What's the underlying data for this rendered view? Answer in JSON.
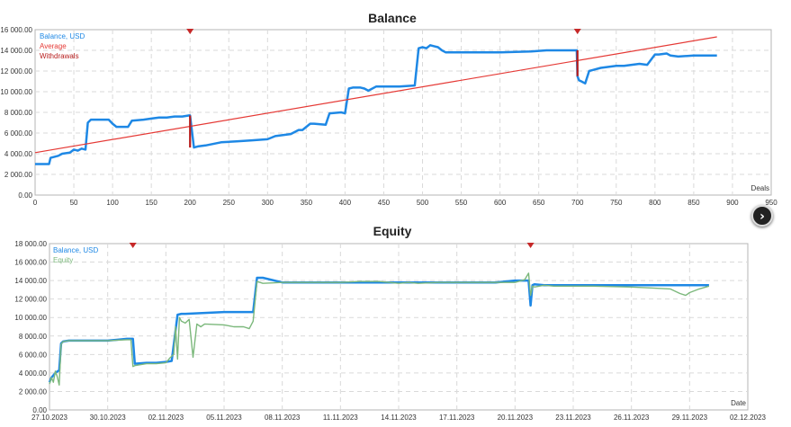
{
  "chart_data": [
    {
      "type": "line",
      "title": "Balance",
      "xlabel": "Deals",
      "ylabel": "",
      "xlim": [
        0,
        950
      ],
      "ylim": [
        0,
        16000
      ],
      "xticks": [
        0,
        50,
        100,
        150,
        200,
        250,
        300,
        350,
        400,
        450,
        500,
        550,
        600,
        650,
        700,
        750,
        800,
        850,
        900,
        950
      ],
      "xtick_labels": [
        "0",
        "50",
        "100",
        "150",
        "200",
        "250",
        "300",
        "350",
        "400",
        "450",
        "500",
        "550",
        "600",
        "650",
        "700",
        "750",
        "800",
        "850",
        "900",
        "950"
      ],
      "yticks": [
        0,
        2000,
        4000,
        6000,
        8000,
        10000,
        12000,
        14000,
        16000
      ],
      "ytick_labels": [
        "0.00",
        "2 000.00",
        "4 000.00",
        "6 000.00",
        "8 000.00",
        "10 000.00",
        "12 000.00",
        "14 000.00",
        "16 000.00"
      ],
      "grid": true,
      "legend": "top-left",
      "markers": [
        200,
        700
      ],
      "series": [
        {
          "name": "Balance, USD",
          "color": "#1e88e5",
          "x": [
            0,
            18,
            20,
            30,
            35,
            45,
            50,
            55,
            60,
            65,
            68,
            72,
            80,
            95,
            100,
            105,
            115,
            120,
            125,
            140,
            150,
            160,
            170,
            180,
            190,
            199,
            200,
            205,
            210,
            220,
            240,
            260,
            280,
            300,
            310,
            320,
            330,
            340,
            345,
            355,
            360,
            375,
            380,
            395,
            400,
            405,
            410,
            420,
            425,
            430,
            440,
            450,
            460,
            470,
            490,
            495,
            500,
            505,
            510,
            515,
            520,
            525,
            530,
            560,
            600,
            640,
            660,
            680,
            699,
            700,
            702,
            705,
            710,
            715,
            720,
            730,
            740,
            750,
            760,
            770,
            780,
            790,
            800,
            805,
            815,
            820,
            830,
            850,
            880
          ],
          "y": [
            3000,
            3000,
            3600,
            3800,
            4000,
            4100,
            4400,
            4300,
            4500,
            4400,
            7000,
            7300,
            7300,
            7300,
            6900,
            6600,
            6600,
            6600,
            7200,
            7300,
            7400,
            7500,
            7500,
            7600,
            7600,
            7700,
            7700,
            4600,
            4700,
            4800,
            5100,
            5200,
            5300,
            5400,
            5700,
            5800,
            5900,
            6300,
            6300,
            6900,
            6900,
            6800,
            7900,
            8000,
            7900,
            10300,
            10400,
            10400,
            10300,
            10100,
            10500,
            10500,
            10500,
            10500,
            10600,
            14200,
            14300,
            14200,
            14500,
            14400,
            14300,
            14000,
            13800,
            13800,
            13800,
            13900,
            14000,
            14000,
            14000,
            11500,
            11100,
            11000,
            10800,
            12000,
            12100,
            12300,
            12400,
            12500,
            12500,
            12600,
            12700,
            12600,
            13600,
            13600,
            13700,
            13500,
            13400,
            13500,
            13500
          ]
        },
        {
          "name": "Average",
          "color": "#e53935",
          "x": [
            0,
            880
          ],
          "y": [
            4100,
            15300
          ]
        },
        {
          "name": "Withdrawals",
          "color": "#b71c1c",
          "segments": [
            [
              200,
              7700,
              4600
            ],
            [
              700,
              14000,
              11500
            ]
          ]
        }
      ]
    },
    {
      "type": "line",
      "title": "Equity",
      "xlabel": "Date",
      "ylabel": "",
      "xlim": [
        0,
        36
      ],
      "ylim": [
        0,
        18000
      ],
      "xticks": [
        0,
        3,
        6,
        9,
        12,
        15,
        18,
        21,
        24,
        27,
        30,
        33,
        36
      ],
      "xtick_labels": [
        "27.10.2023",
        "30.10.2023",
        "02.11.2023",
        "05.11.2023",
        "08.11.2023",
        "11.11.2023",
        "14.11.2023",
        "17.11.2023",
        "20.11.2023",
        "23.11.2023",
        "26.11.2023",
        "29.11.2023",
        "02.12.2023"
      ],
      "yticks": [
        0,
        2000,
        4000,
        6000,
        8000,
        10000,
        12000,
        14000,
        16000,
        18000
      ],
      "ytick_labels": [
        "0.00",
        "2 000.00",
        "4 000.00",
        "6 000.00",
        "8 000.00",
        "10 000.00",
        "12 000.00",
        "14 000.00",
        "16 000.00",
        "18 000.00"
      ],
      "grid": true,
      "legend": "top-left",
      "markers": [
        4.3,
        24.8
      ],
      "series": [
        {
          "name": "Balance, USD",
          "color": "#1e88e5",
          "x": [
            0,
            0.1,
            0.3,
            0.5,
            0.6,
            0.7,
            1,
            2,
            3,
            4,
            4.3,
            4.4,
            5,
            5.5,
            6,
            6.3,
            6.6,
            6.8,
            7,
            8,
            9,
            10,
            10.5,
            10.7,
            11,
            12,
            13,
            14,
            15,
            16,
            17,
            18,
            19,
            20,
            21,
            22,
            23,
            24,
            24.7,
            24.8,
            24.9,
            25,
            25.5,
            26,
            28,
            30,
            32,
            33,
            34
          ],
          "y": [
            3000,
            3500,
            4000,
            4300,
            7200,
            7400,
            7500,
            7500,
            7500,
            7700,
            7700,
            5000,
            5100,
            5100,
            5200,
            5300,
            10300,
            10400,
            10400,
            10500,
            10600,
            10600,
            10600,
            14300,
            14300,
            13800,
            13800,
            13800,
            13800,
            13800,
            13800,
            13800,
            13800,
            13800,
            13800,
            13800,
            13800,
            14000,
            14000,
            11300,
            13500,
            13600,
            13500,
            13500,
            13500,
            13500,
            13500,
            13500,
            13500
          ]
        },
        {
          "name": "Equity",
          "color": "#7cb87c",
          "x": [
            0,
            0.1,
            0.2,
            0.3,
            0.4,
            0.5,
            0.6,
            0.7,
            1,
            2,
            3,
            4,
            4.2,
            4.3,
            4.4,
            5,
            5.5,
            6,
            6.2,
            6.4,
            6.5,
            6.6,
            6.7,
            6.8,
            7,
            7.2,
            7.4,
            7.6,
            7.8,
            8,
            9,
            9.5,
            10,
            10.3,
            10.5,
            10.7,
            11,
            12,
            13,
            14,
            15,
            16,
            17,
            18,
            18.5,
            19,
            20,
            21,
            22,
            23,
            24,
            24.5,
            24.7,
            24.8,
            24.9,
            25,
            25.5,
            26,
            28,
            30,
            31,
            32,
            32.5,
            32.8,
            33,
            33.5,
            34
          ],
          "y": [
            2800,
            3500,
            3000,
            4200,
            3600,
            2700,
            7100,
            7400,
            7500,
            7500,
            7500,
            7600,
            7600,
            4700,
            4800,
            5000,
            5000,
            5100,
            5600,
            6000,
            9000,
            5500,
            10000,
            9600,
            9400,
            9800,
            5700,
            9300,
            9000,
            9300,
            9200,
            9000,
            9000,
            8800,
            9600,
            13900,
            13700,
            13800,
            13800,
            13800,
            13800,
            13900,
            13900,
            13700,
            13800,
            13700,
            13800,
            13800,
            13800,
            13800,
            13800,
            14100,
            14800,
            12400,
            13400,
            13300,
            13500,
            13400,
            13400,
            13300,
            13200,
            13100,
            12600,
            12400,
            12700,
            13100,
            13400
          ]
        }
      ]
    }
  ]
}
